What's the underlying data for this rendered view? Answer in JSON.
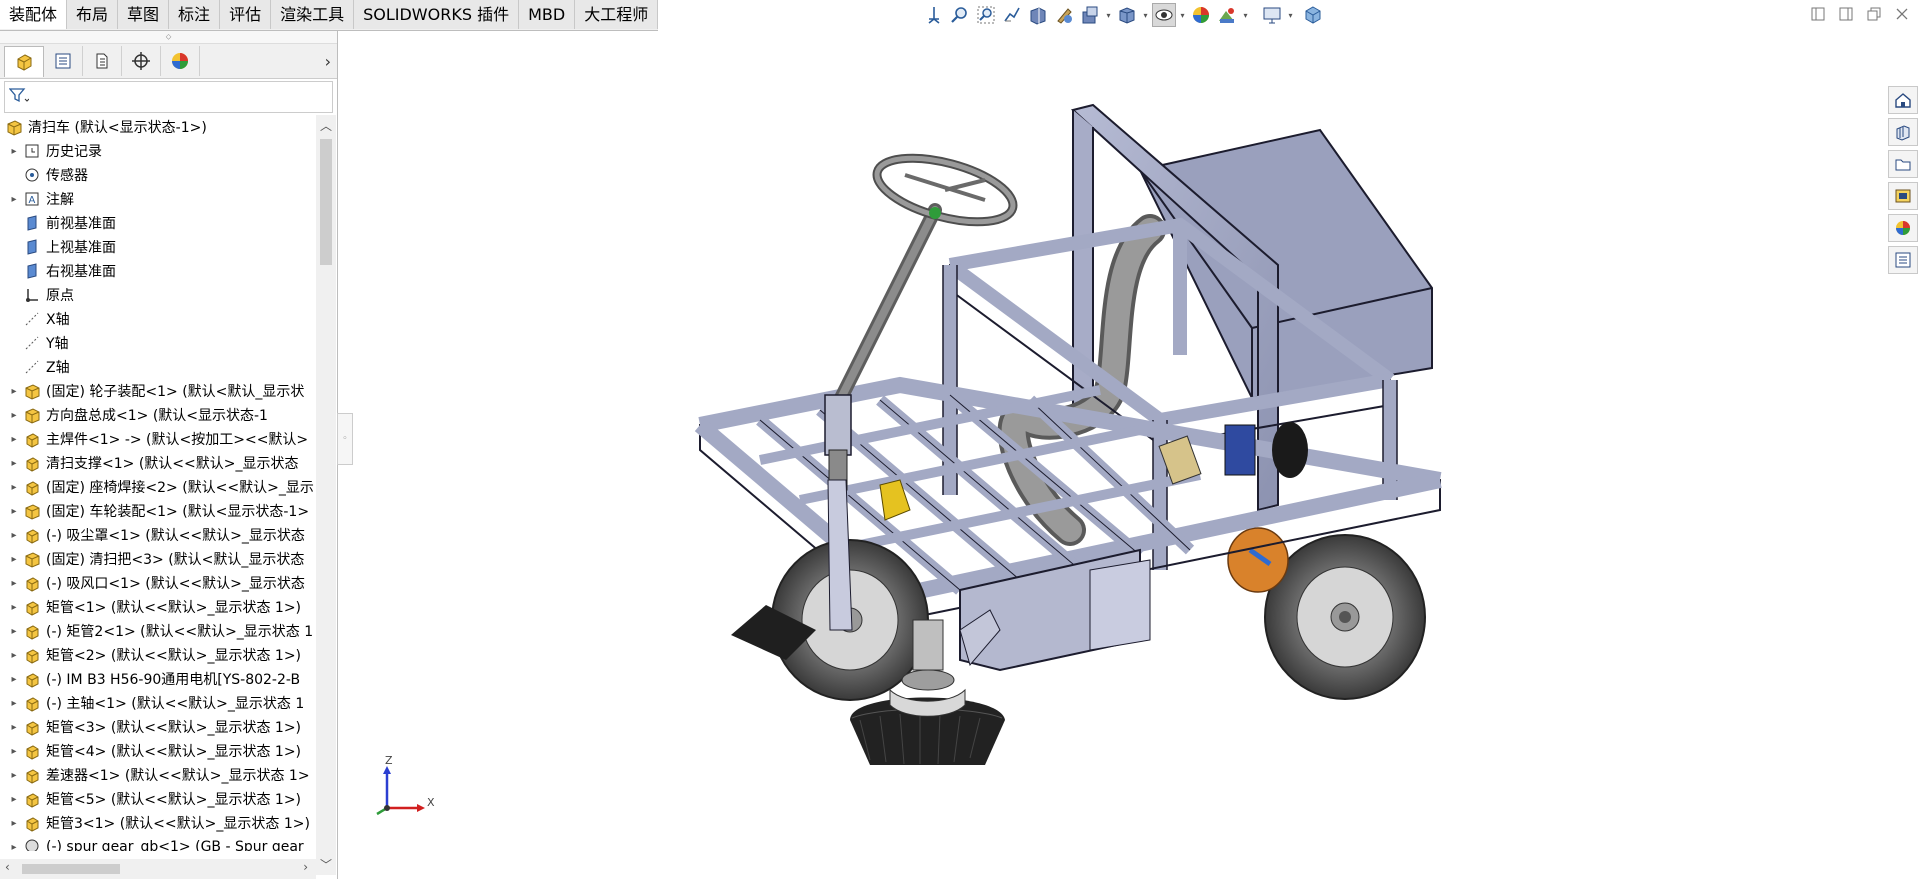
{
  "menu_tabs": [
    "装配体",
    "布局",
    "草图",
    "标注",
    "评估",
    "渲染工具",
    "SOLIDWORKS 插件",
    "MBD",
    "大工程师"
  ],
  "active_tab": "装配体",
  "hud_icons": [
    "view-orientation-icon",
    "zoom-to-fit-icon",
    "zoom-to-area-icon",
    "previous-view-icon",
    "section-view-icon",
    "dynamic-annotation-icon",
    "view-settings-icon",
    "display-style-icon",
    "hide-show-icon",
    "edit-appearance-icon",
    "apply-scene-icon",
    "view-display-icon",
    "view-cube-icon"
  ],
  "feature_manager": {
    "tab_icons": [
      "featuremanager-icon",
      "propertymanager-icon",
      "configurationmanager-icon",
      "dimxpertmanager-icon",
      "displaymanager-icon"
    ],
    "filter_icon": "filter-icon",
    "tree": [
      {
        "label": "清扫车  (默认<显示状态-1>)",
        "icon": "assembly-icon",
        "expand": "",
        "indent": 0
      },
      {
        "label": "历史记录",
        "icon": "history-icon",
        "expand": "▸",
        "indent": 1
      },
      {
        "label": "传感器",
        "icon": "sensor-icon",
        "expand": "",
        "indent": 1
      },
      {
        "label": "注解",
        "icon": "annotation-icon",
        "expand": "▸",
        "indent": 1
      },
      {
        "label": "前视基准面",
        "icon": "plane-icon",
        "expand": "",
        "indent": 1
      },
      {
        "label": "上视基准面",
        "icon": "plane-icon",
        "expand": "",
        "indent": 1
      },
      {
        "label": "右视基准面",
        "icon": "plane-icon",
        "expand": "",
        "indent": 1
      },
      {
        "label": "原点",
        "icon": "origin-icon",
        "expand": "",
        "indent": 1
      },
      {
        "label": "X轴",
        "icon": "axis-icon",
        "expand": "",
        "indent": 1
      },
      {
        "label": "Y轴",
        "icon": "axis-icon",
        "expand": "",
        "indent": 1
      },
      {
        "label": "Z轴",
        "icon": "axis-icon",
        "expand": "",
        "indent": 1
      },
      {
        "label": "(固定) 轮子装配<1> (默认<默认_显示状",
        "icon": "subassembly-icon",
        "expand": "▸",
        "indent": 1
      },
      {
        "label": "方向盘总成<1> (默认<显示状态-1",
        "icon": "subassembly-icon",
        "expand": "▸",
        "indent": 1
      },
      {
        "label": "主焊件<1> -> (默认<按加工><<默认>",
        "icon": "part-icon",
        "expand": "▸",
        "indent": 1
      },
      {
        "label": "清扫支撑<1> (默认<<默认>_显示状态",
        "icon": "part-icon",
        "expand": "▸",
        "indent": 1
      },
      {
        "label": "(固定) 座椅焊接<2> (默认<<默认>_显示",
        "icon": "part-icon",
        "expand": "▸",
        "indent": 1
      },
      {
        "label": "(固定) 车轮装配<1> (默认<显示状态-1>",
        "icon": "subassembly-icon",
        "expand": "▸",
        "indent": 1
      },
      {
        "label": "(-) 吸尘罩<1> (默认<<默认>_显示状态",
        "icon": "part-icon",
        "expand": "▸",
        "indent": 1
      },
      {
        "label": "(固定) 清扫把<3> (默认<默认_显示状态",
        "icon": "subassembly-icon",
        "expand": "▸",
        "indent": 1
      },
      {
        "label": "(-) 吸风口<1> (默认<<默认>_显示状态",
        "icon": "part-icon",
        "expand": "▸",
        "indent": 1
      },
      {
        "label": "矩管<1> (默认<<默认>_显示状态 1>)",
        "icon": "part-icon",
        "expand": "▸",
        "indent": 1
      },
      {
        "label": "(-) 矩管2<1> (默认<<默认>_显示状态 1",
        "icon": "part-icon",
        "expand": "▸",
        "indent": 1
      },
      {
        "label": "矩管<2> (默认<<默认>_显示状态 1>)",
        "icon": "part-icon",
        "expand": "▸",
        "indent": 1
      },
      {
        "label": "(-) IM B3 H56-90通用电机[YS-802-2-B",
        "icon": "part-icon",
        "expand": "▸",
        "indent": 1
      },
      {
        "label": "(-) 主轴<1> (默认<<默认>_显示状态 1",
        "icon": "part-icon",
        "expand": "▸",
        "indent": 1
      },
      {
        "label": "矩管<3> (默认<<默认>_显示状态 1>)",
        "icon": "part-icon",
        "expand": "▸",
        "indent": 1
      },
      {
        "label": "矩管<4> (默认<<默认>_显示状态 1>)",
        "icon": "part-icon",
        "expand": "▸",
        "indent": 1
      },
      {
        "label": "差速器<1> (默认<<默认>_显示状态 1>",
        "icon": "part-icon",
        "expand": "▸",
        "indent": 1
      },
      {
        "label": "矩管<5> (默认<<默认>_显示状态 1>)",
        "icon": "part-icon",
        "expand": "▸",
        "indent": 1
      },
      {
        "label": "矩管3<1> (默认<<默认>_显示状态 1>)",
        "icon": "part-icon",
        "expand": "▸",
        "indent": 1
      },
      {
        "label": "(-) spur gear_gb<1> (GB - Spur gear",
        "icon": "toolbox-part-icon",
        "expand": "▸",
        "indent": 1
      }
    ]
  },
  "taskpane_icons": [
    "home-icon",
    "design-library-icon",
    "file-explorer-icon",
    "view-palette-icon",
    "appearances-icon",
    "custom-properties-icon"
  ],
  "window_icons": [
    "restore-tile-left-icon",
    "tile-right-icon",
    "maximize-icon",
    "close-icon"
  ],
  "triad": {
    "x": "X",
    "z": "Z"
  },
  "model": {
    "name": "清扫车",
    "frame_color": "#a3a9c4"
  }
}
